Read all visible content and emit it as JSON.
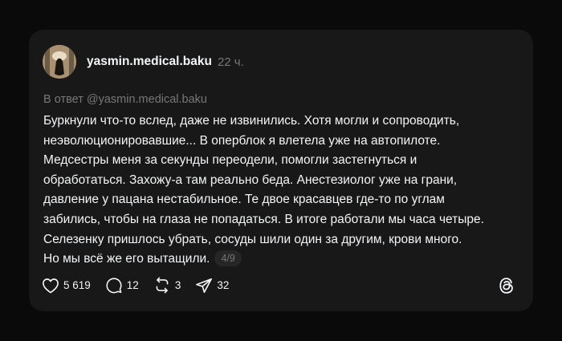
{
  "post": {
    "username": "yasmin.medical.baku",
    "time": "22 ч.",
    "reply_to": "В ответ @yasmin.medical.baku",
    "lines": [
      "Буркнули что-то вслед, даже не извинились. Хотя могли и сопроводить,",
      "неэволюционировавшие... В оперблок я влетела уже на автопилоте.",
      "Медсестры меня за секунды переодели, помогли застегнуться и",
      "обработаться. Захожу-а там реально беда. Анестезиолог уже на грани,",
      "давление у пацана нестабильное. Те двое красавцев где-то по углам",
      "забились, чтобы на глаза не попадаться. В итоге работали мы часа четыре.",
      "Селезенку пришлось убрать, сосуды шили один за другим, крови много.",
      "Но мы всё же его вытащили."
    ],
    "pager": "4/9"
  },
  "actions": {
    "likes": "5 619",
    "comments": "12",
    "reposts": "3",
    "shares": "32"
  },
  "icons": {
    "like": "heart-icon",
    "comment": "comment-icon",
    "repost": "repost-icon",
    "share": "share-icon",
    "brand": "threads-logo-icon"
  },
  "colors": {
    "background": "#0a0a0a",
    "card": "#181818",
    "text": "#f3f5f7",
    "muted": "#777777"
  }
}
